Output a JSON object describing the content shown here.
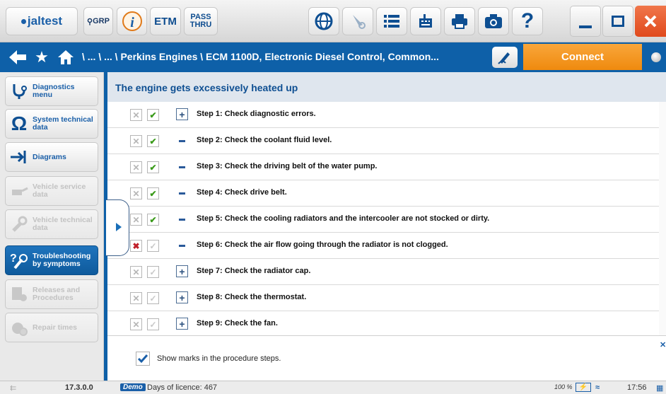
{
  "titlebar": {
    "logo_text": "jaltest",
    "grp_label": "GRP",
    "info_icon": "info-icon",
    "etm_label": "ETM",
    "pass_thru_label": [
      "PASS",
      "THRU"
    ],
    "icons": [
      "globe-icon",
      "stylus-icon",
      "list-icon",
      "keyboard-icon",
      "printer-icon",
      "camera-icon",
      "help-icon"
    ],
    "window_buttons": [
      "minimize-icon",
      "maximize-icon",
      "close-icon"
    ],
    "help_glyph": "?"
  },
  "navbar": {
    "breadcrumb": "\\ ... \\ ... \\ Perkins Engines \\ ECM 1100D, Electronic Diesel Control, Common...",
    "connect_label": "Connect"
  },
  "sidebar": {
    "items": [
      {
        "label": "Diagnostics menu",
        "lines": [
          "Diagnostics",
          "menu"
        ],
        "icon": "stethoscope-icon",
        "state": "normal"
      },
      {
        "label": "System technical data",
        "lines": [
          "System technical",
          "data"
        ],
        "icon": "omega-icon",
        "state": "normal"
      },
      {
        "label": "Diagrams",
        "lines": [
          "Diagrams"
        ],
        "icon": "diagram-icon",
        "state": "normal"
      },
      {
        "label": "Vehicle service data",
        "lines": [
          "Vehicle service",
          "data"
        ],
        "icon": "oil-can-icon",
        "state": "disabled"
      },
      {
        "label": "Vehicle technical data",
        "lines": [
          "Vehicle technical",
          "data"
        ],
        "icon": "wrench-icon",
        "state": "disabled"
      },
      {
        "label": "Troubleshooting by symptoms",
        "lines": [
          "Troubleshooting",
          "by symptoms"
        ],
        "icon": "troubleshoot-icon",
        "state": "active"
      },
      {
        "label": "Releases and Procedures",
        "lines": [
          "Releases and",
          "Procedures"
        ],
        "icon": "procedures-icon",
        "state": "disabled"
      },
      {
        "label": "Repair times",
        "lines": [
          "Repair times"
        ],
        "icon": "repair-time-icon",
        "state": "disabled"
      }
    ]
  },
  "main": {
    "title": "The engine gets excessively heated up",
    "steps": [
      {
        "text": "Step 1: Check diagnostic errors.",
        "x_marked": false,
        "check_marked": true,
        "expander": "plus"
      },
      {
        "text": "Step 2: Check the coolant fluid level.",
        "x_marked": false,
        "check_marked": true,
        "expander": "dash"
      },
      {
        "text": "Step 3: Check the driving belt of the water pump.",
        "x_marked": false,
        "check_marked": true,
        "expander": "dash"
      },
      {
        "text": "Step 4: Check drive belt.",
        "x_marked": false,
        "check_marked": true,
        "expander": "dash"
      },
      {
        "text": "Step 5: Check the cooling radiators and the intercooler are not stocked or dirty.",
        "x_marked": false,
        "check_marked": true,
        "expander": "dash"
      },
      {
        "text": "Step 6: Check the air flow going through the radiator is not clogged.",
        "x_marked": true,
        "check_marked": false,
        "expander": "dash"
      },
      {
        "text": "Step 7: Check the radiator cap.",
        "x_marked": false,
        "check_marked": false,
        "expander": "plus"
      },
      {
        "text": "Step 8: Check the thermostat.",
        "x_marked": false,
        "check_marked": false,
        "expander": "plus"
      },
      {
        "text": "Step 9: Check the fan.",
        "x_marked": false,
        "check_marked": false,
        "expander": "plus"
      }
    ],
    "show_marks_label": "Show marks in the procedure steps.",
    "show_marks_checked": true
  },
  "statusbar": {
    "version": "17.3.0.0",
    "demo_badge": "Demo",
    "licence": "Days of licence: 467",
    "battery": "100 %",
    "time": "17:56"
  },
  "colors": {
    "brand_blue": "#0e60a8",
    "connect_orange": "#f39a1f",
    "close_red": "#e8562a",
    "check_green": "#3a9a1a",
    "x_red": "#c0202a"
  }
}
